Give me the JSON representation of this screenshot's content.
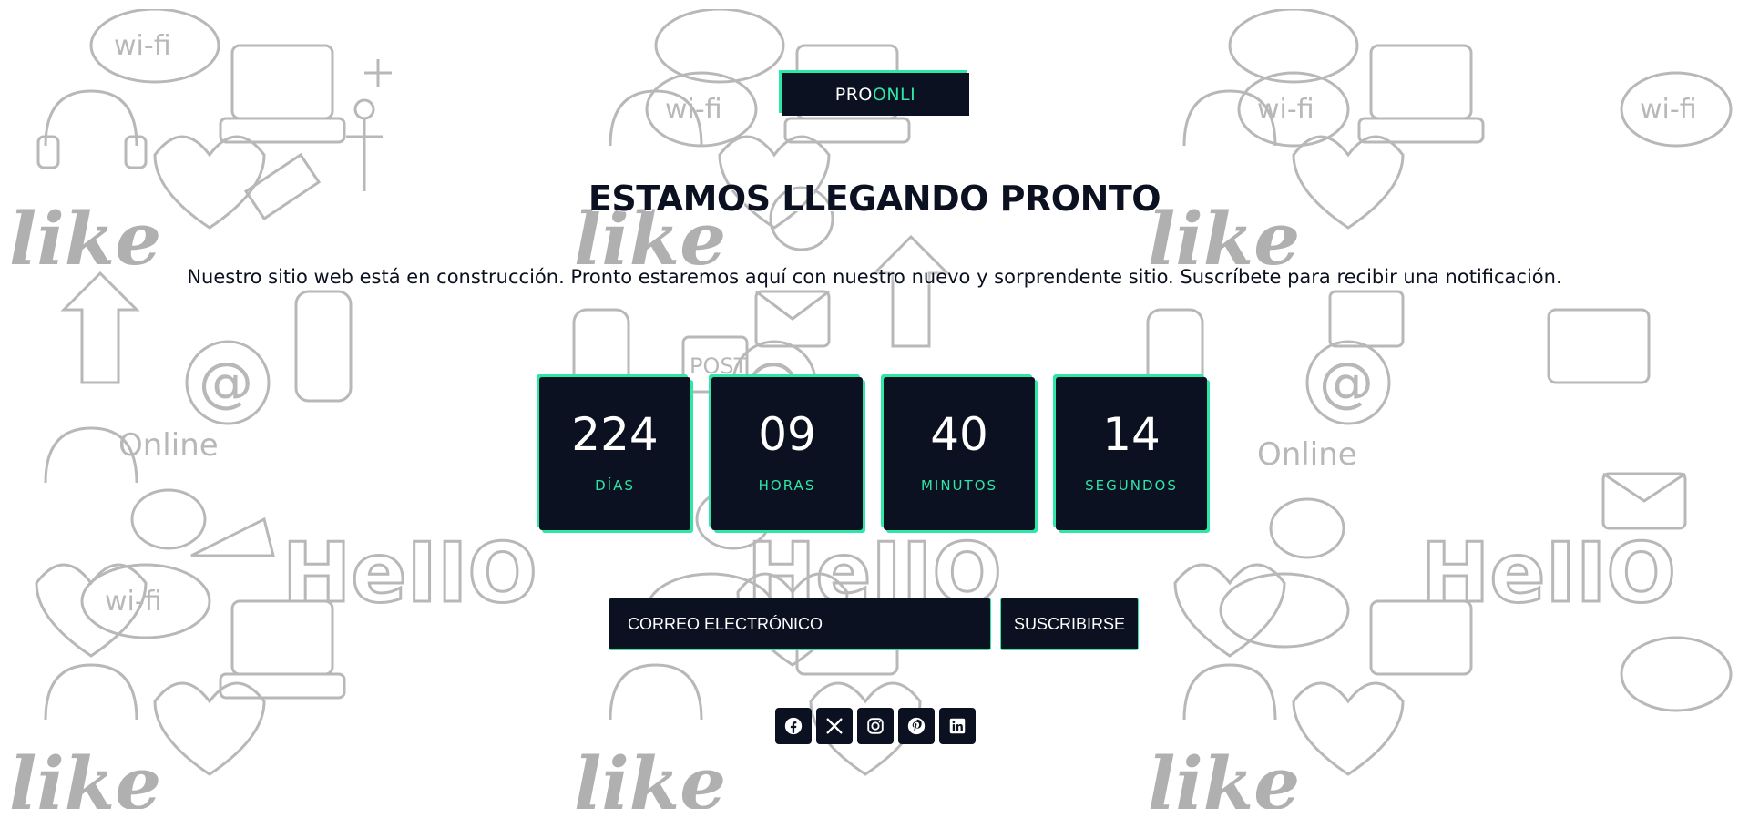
{
  "logo": {
    "part1": "PRO",
    "part2": "ONLI"
  },
  "heading": "ESTAMOS LLEGANDO PRONTO",
  "subtitle": "Nuestro sitio web está en construcción. Pronto estaremos aquí con nuestro nuevo y sorprendente sitio. Suscríbete para recibir una notificación.",
  "countdown": [
    {
      "value": "224",
      "label": "DÍAS"
    },
    {
      "value": "09",
      "label": "HORAS"
    },
    {
      "value": "40",
      "label": "MINUTOS"
    },
    {
      "value": "14",
      "label": "SEGUNDOS"
    }
  ],
  "form": {
    "email_placeholder": "CORREO ELECTRÓNICO",
    "email_value": "",
    "submit_label": "SUSCRIBIRSE"
  },
  "social": [
    {
      "icon": "facebook-icon"
    },
    {
      "icon": "x-twitter-icon"
    },
    {
      "icon": "instagram-icon"
    },
    {
      "icon": "pinterest-icon"
    },
    {
      "icon": "linkedin-icon"
    }
  ],
  "colors": {
    "dark": "#0b1120",
    "accent": "#2ee6a6",
    "background": "#ffffff",
    "doodle": "#b3b3b3"
  }
}
